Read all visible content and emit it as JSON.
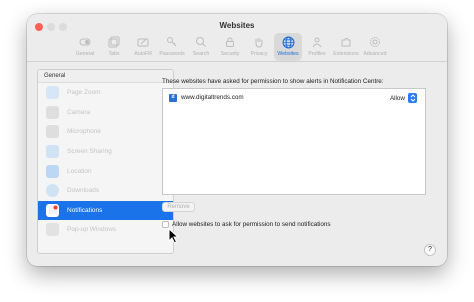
{
  "window": {
    "title": "Websites"
  },
  "toolbar": {
    "items": [
      {
        "label": "General",
        "icon": "switch-icon"
      },
      {
        "label": "Tabs",
        "icon": "tabs-icon"
      },
      {
        "label": "AutoFill",
        "icon": "pencil-icon"
      },
      {
        "label": "Passwords",
        "icon": "key-icon"
      },
      {
        "label": "Search",
        "icon": "search-icon"
      },
      {
        "label": "Security",
        "icon": "lock-icon"
      },
      {
        "label": "Privacy",
        "icon": "hand-icon"
      },
      {
        "label": "Websites",
        "icon": "globe-icon",
        "active": true
      },
      {
        "label": "Profiles",
        "icon": "person-icon"
      },
      {
        "label": "Extensions",
        "icon": "puzzle-icon"
      },
      {
        "label": "Advanced",
        "icon": "gear-icon"
      }
    ]
  },
  "sidebar": {
    "header": "General",
    "items": [
      {
        "label": "Page Zoom",
        "icon": "zoom-icon"
      },
      {
        "label": "Camera",
        "icon": "camera-icon"
      },
      {
        "label": "Microphone",
        "icon": "microphone-icon"
      },
      {
        "label": "Screen Sharing",
        "icon": "screen-sharing-icon"
      },
      {
        "label": "Location",
        "icon": "location-icon"
      },
      {
        "label": "Downloads",
        "icon": "downloads-icon"
      },
      {
        "label": "Notifications",
        "icon": "bell-icon",
        "active": true
      },
      {
        "label": "Pop-up Windows",
        "icon": "popup-icon"
      }
    ]
  },
  "main": {
    "description": "These websites have asked for permission to show alerts in Notification Centre:",
    "sites": [
      {
        "name": "www.digitaltrends.com",
        "permission": "Allow"
      }
    ],
    "remove_label": "Remove",
    "allow_checkbox_label": "Allow websites to ask for permission to send notifications",
    "help_label": "?"
  },
  "colors": {
    "accent": "#1a73e8",
    "close": "#ff5f57"
  }
}
